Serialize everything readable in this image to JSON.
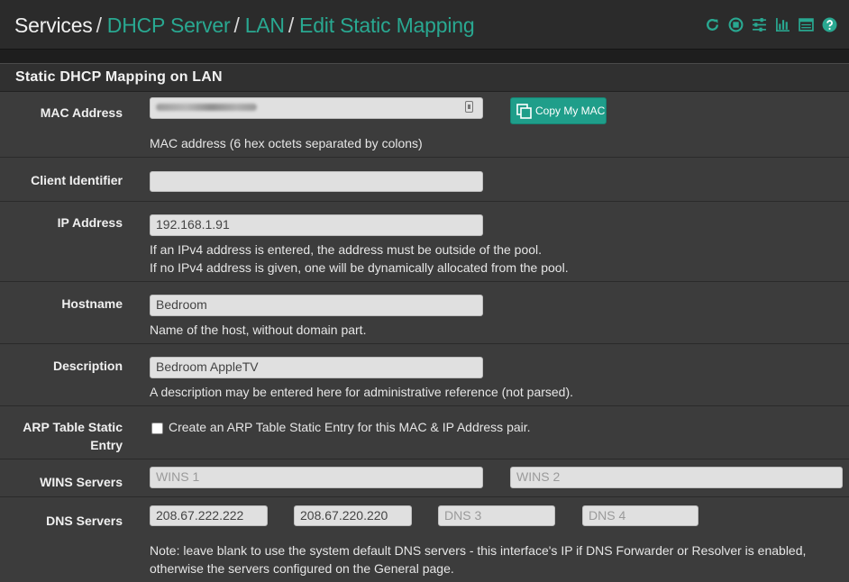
{
  "breadcrumb": {
    "items": [
      "Services",
      "DHCP Server",
      "LAN",
      "Edit Static Mapping"
    ],
    "separator": "/"
  },
  "toolbar": {
    "icons": [
      "reload-icon",
      "stop-icon",
      "sliders-icon",
      "bar-chart-icon",
      "list-icon",
      "help-icon"
    ]
  },
  "colors": {
    "accent": "#29a891",
    "button": "#1f9e8a",
    "panel": "#3c3c3c"
  },
  "panel": {
    "title": "Static DHCP Mapping on LAN"
  },
  "form": {
    "mac": {
      "label": "MAC Address",
      "value": "",
      "copy_button": "Copy My MAC",
      "help": "MAC address (6 hex octets separated by colons)"
    },
    "client_id": {
      "label": "Client Identifier",
      "value": ""
    },
    "ip": {
      "label": "IP Address",
      "value": "192.168.1.91",
      "help1": "If an IPv4 address is entered, the address must be outside of the pool.",
      "help2": "If no IPv4 address is given, one will be dynamically allocated from the pool."
    },
    "hostname": {
      "label": "Hostname",
      "value": "Bedroom",
      "help": "Name of the host, without domain part."
    },
    "description": {
      "label": "Description",
      "value": "Bedroom AppleTV",
      "help": "A description may be entered here for administrative reference (not parsed)."
    },
    "arp": {
      "label_line1": "ARP Table Static",
      "label_line2": "Entry",
      "checkbox_label": "Create an ARP Table Static Entry for this MAC & IP Address pair.",
      "checked": false
    },
    "wins": {
      "label": "WINS Servers",
      "wins1_placeholder": "WINS 1",
      "wins2_placeholder": "WINS 2"
    },
    "dns": {
      "label": "DNS Servers",
      "dns1": "208.67.222.222",
      "dns2": "208.67.220.220",
      "dns3_placeholder": "DNS 3",
      "dns4_placeholder": "DNS 4",
      "note1": "Note: leave blank to use the system default DNS servers - this interface's IP if DNS Forwarder or Resolver is enabled,",
      "note2": "otherwise the servers configured on the General page."
    }
  }
}
